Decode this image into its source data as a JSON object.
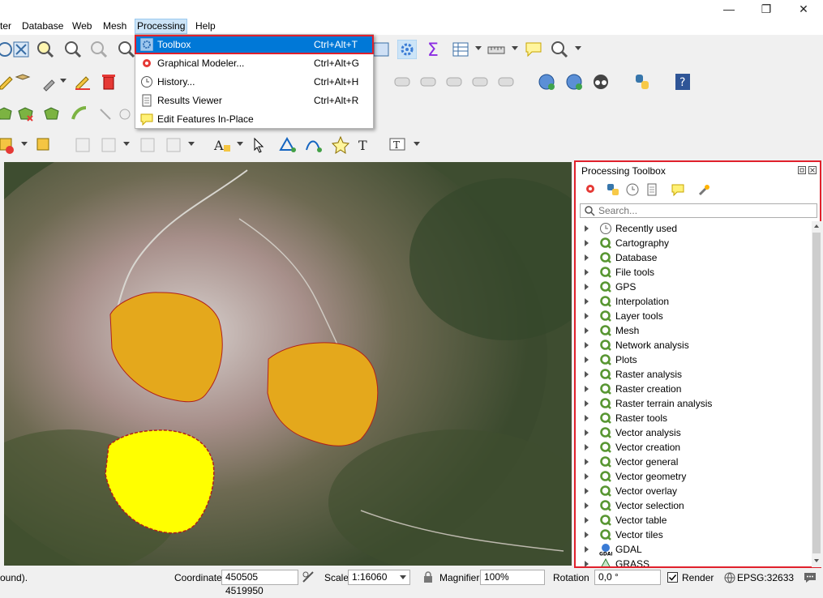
{
  "window": {
    "minimize": "—",
    "restore": "❐",
    "close": "✕"
  },
  "menubar": {
    "items": [
      {
        "label": "ter"
      },
      {
        "label": "Database"
      },
      {
        "label": "Web"
      },
      {
        "label": "Mesh"
      },
      {
        "label": "Processing"
      },
      {
        "label": "Help"
      }
    ]
  },
  "processing_menu": {
    "items": [
      {
        "label": "Toolbox",
        "shortcut": "Ctrl+Alt+T",
        "icon": "gear-icon"
      },
      {
        "label": "Graphical Modeler...",
        "shortcut": "Ctrl+Alt+G",
        "icon": "modeler-icon"
      },
      {
        "label": "History...",
        "shortcut": "Ctrl+Alt+H",
        "icon": "clock-icon"
      },
      {
        "label": "Results Viewer",
        "shortcut": "Ctrl+Alt+R",
        "icon": "document-icon"
      },
      {
        "label": "Edit Features In-Place",
        "shortcut": "",
        "icon": "edit-in-place-icon"
      }
    ]
  },
  "toolbox": {
    "title": "Processing Toolbox",
    "search_placeholder": "Search...",
    "tree": [
      {
        "label": "Recently used",
        "icon": "clock-icon"
      },
      {
        "label": "Cartography",
        "icon": "qgis-icon"
      },
      {
        "label": "Database",
        "icon": "qgis-icon"
      },
      {
        "label": "File tools",
        "icon": "qgis-icon"
      },
      {
        "label": "GPS",
        "icon": "qgis-icon"
      },
      {
        "label": "Interpolation",
        "icon": "qgis-icon"
      },
      {
        "label": "Layer tools",
        "icon": "qgis-icon"
      },
      {
        "label": "Mesh",
        "icon": "qgis-icon"
      },
      {
        "label": "Network analysis",
        "icon": "qgis-icon"
      },
      {
        "label": "Plots",
        "icon": "qgis-icon"
      },
      {
        "label": "Raster analysis",
        "icon": "qgis-icon"
      },
      {
        "label": "Raster creation",
        "icon": "qgis-icon"
      },
      {
        "label": "Raster terrain analysis",
        "icon": "qgis-icon"
      },
      {
        "label": "Raster tools",
        "icon": "qgis-icon"
      },
      {
        "label": "Vector analysis",
        "icon": "qgis-icon"
      },
      {
        "label": "Vector creation",
        "icon": "qgis-icon"
      },
      {
        "label": "Vector general",
        "icon": "qgis-icon"
      },
      {
        "label": "Vector geometry",
        "icon": "qgis-icon"
      },
      {
        "label": "Vector overlay",
        "icon": "qgis-icon"
      },
      {
        "label": "Vector selection",
        "icon": "qgis-icon"
      },
      {
        "label": "Vector table",
        "icon": "qgis-icon"
      },
      {
        "label": "Vector tiles",
        "icon": "qgis-icon"
      },
      {
        "label": "GDAL",
        "icon": "gdal-icon"
      },
      {
        "label": "GRASS",
        "icon": "grass-icon"
      }
    ]
  },
  "statusbar": {
    "message": "ound).",
    "coordinate_label": "Coordinate",
    "coordinate_value": "450505 4519950",
    "scale_label": "Scale",
    "scale_value": "1:16060",
    "magnifier_label": "Magnifier",
    "magnifier_value": "100%",
    "rotation_label": "Rotation",
    "rotation_value": "0,0 °",
    "render_label": "Render",
    "crs": "EPSG:32633"
  },
  "colors": {
    "accent": "#0078d7",
    "highlight_border": "#e0202c",
    "polygon_orange": "#e4a81c",
    "polygon_yellow": "#ffff00",
    "polygon_outline": "#b0201a"
  }
}
